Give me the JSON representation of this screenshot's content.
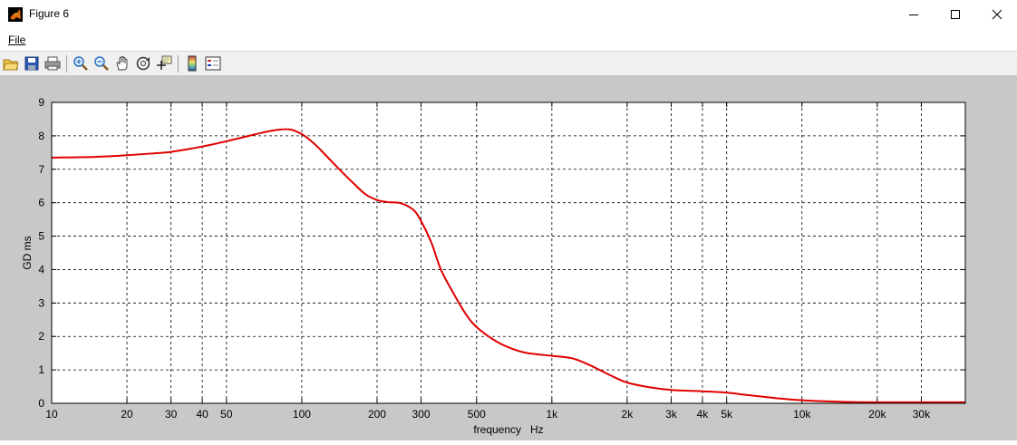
{
  "window": {
    "title": "Figure 6",
    "menu": [
      "File"
    ]
  },
  "toolbar": {
    "icons": [
      "open-icon",
      "save-icon",
      "print-icon",
      "zoom-in-icon",
      "zoom-out-icon",
      "pan-icon",
      "rotate-3d-icon",
      "data-cursor-icon",
      "colorbar-icon",
      "legend-icon"
    ]
  },
  "colors": {
    "line": "#e00000",
    "figure_bg": "#c8c8c8",
    "grid": "#000000"
  },
  "chart_data": {
    "type": "line",
    "title": "",
    "xlabel": "frequency   Hz",
    "ylabel": "GD ms",
    "xscale": "log",
    "xlim": [
      10,
      45000
    ],
    "ylim": [
      0,
      9
    ],
    "grid": true,
    "xticks": [
      {
        "v": 10,
        "label": "10"
      },
      {
        "v": 20,
        "label": "20"
      },
      {
        "v": 30,
        "label": "30"
      },
      {
        "v": 40,
        "label": "40"
      },
      {
        "v": 50,
        "label": "50"
      },
      {
        "v": 100,
        "label": "100"
      },
      {
        "v": 200,
        "label": "200"
      },
      {
        "v": 300,
        "label": "300"
      },
      {
        "v": 500,
        "label": "500"
      },
      {
        "v": 1000,
        "label": "1k"
      },
      {
        "v": 2000,
        "label": "2k"
      },
      {
        "v": 3000,
        "label": "3k"
      },
      {
        "v": 4000,
        "label": "4k"
      },
      {
        "v": 5000,
        "label": "5k"
      },
      {
        "v": 10000,
        "label": "10k"
      },
      {
        "v": 20000,
        "label": "20k"
      },
      {
        "v": 30000,
        "label": "30k"
      }
    ],
    "yticks": [
      0,
      1,
      2,
      3,
      4,
      5,
      6,
      7,
      8,
      9
    ],
    "series": [
      {
        "color": "#e00000",
        "x": [
          10,
          15,
          20,
          25,
          30,
          35,
          40,
          45,
          50,
          60,
          70,
          80,
          90,
          100,
          110,
          120,
          140,
          160,
          180,
          200,
          220,
          250,
          280,
          300,
          330,
          360,
          400,
          450,
          500,
          600,
          700,
          800,
          1000,
          1200,
          1400,
          1700,
          2000,
          2500,
          3000,
          4000,
          5000,
          6000,
          8000,
          10000,
          15000,
          20000,
          30000,
          45000
        ],
        "y": [
          7.35,
          7.37,
          7.42,
          7.47,
          7.52,
          7.6,
          7.68,
          7.76,
          7.84,
          7.98,
          8.1,
          8.18,
          8.19,
          8.05,
          7.82,
          7.55,
          7.03,
          6.6,
          6.25,
          6.08,
          6.02,
          5.98,
          5.78,
          5.45,
          4.8,
          4.0,
          3.35,
          2.7,
          2.28,
          1.85,
          1.62,
          1.5,
          1.42,
          1.35,
          1.16,
          0.85,
          0.62,
          0.47,
          0.4,
          0.36,
          0.32,
          0.25,
          0.15,
          0.09,
          0.04,
          0.03,
          0.03,
          0.03
        ]
      }
    ]
  }
}
